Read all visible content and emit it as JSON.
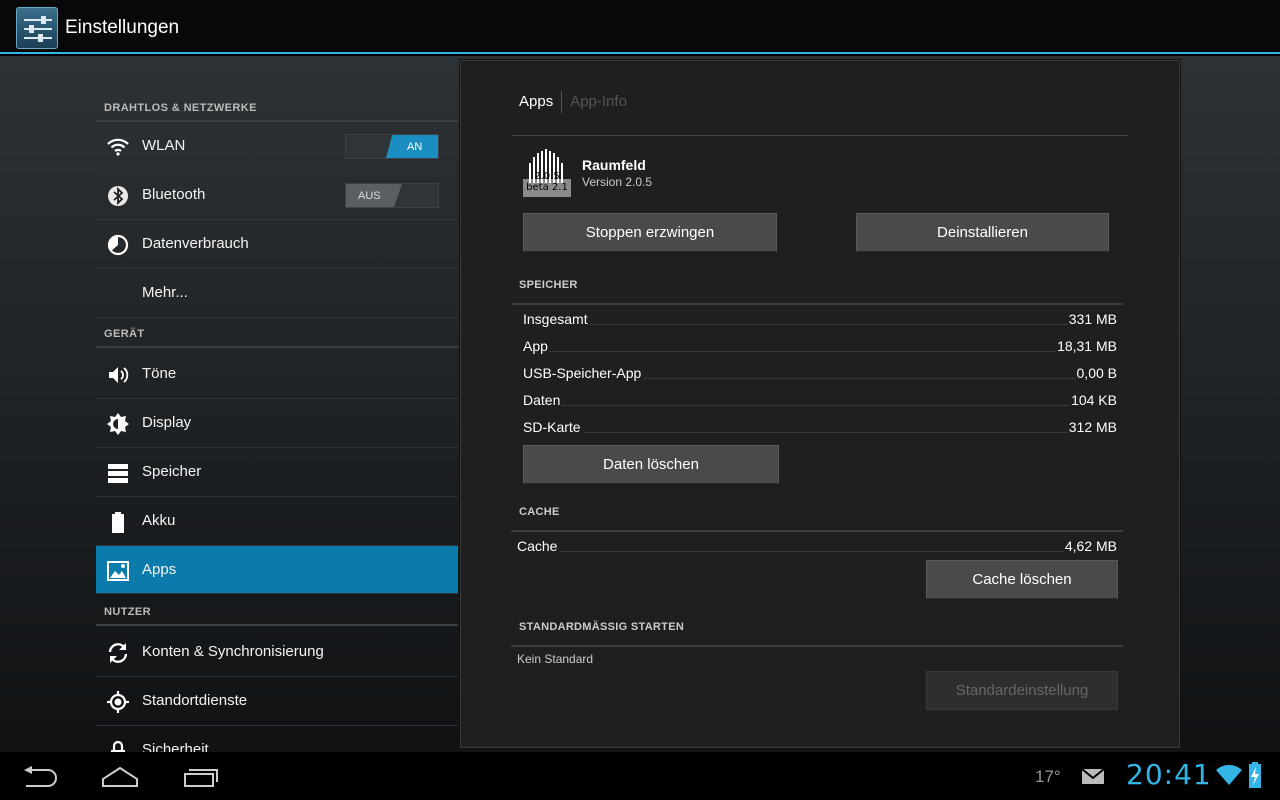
{
  "actionbar": {
    "title": "Einstellungen",
    "icon": "settings-sliders-icon"
  },
  "sidebar": {
    "sections": [
      {
        "header": "DRAHTLOS & NETZWERKE"
      },
      {
        "header": "GERÄT"
      },
      {
        "header": "NUTZER"
      }
    ],
    "items": [
      {
        "label": "WLAN",
        "icon": "wifi-icon",
        "toggle": "AN",
        "toggle_state": "on"
      },
      {
        "label": "Bluetooth",
        "icon": "bluetooth-icon",
        "toggle": "AUS",
        "toggle_state": "off"
      },
      {
        "label": "Datenverbrauch",
        "icon": "data-usage-icon"
      },
      {
        "label": "Mehr..."
      },
      {
        "label": "Töne",
        "icon": "speaker-icon"
      },
      {
        "label": "Display",
        "icon": "brightness-icon"
      },
      {
        "label": "Speicher",
        "icon": "storage-icon"
      },
      {
        "label": "Akku",
        "icon": "battery-icon"
      },
      {
        "label": "Apps",
        "icon": "apps-icon",
        "selected": true
      },
      {
        "label": "Konten & Synchronisierung",
        "icon": "sync-icon"
      },
      {
        "label": "Standortdienste",
        "icon": "location-icon"
      },
      {
        "label": "Sicherheit",
        "icon": "lock-icon"
      }
    ]
  },
  "panel": {
    "breadcrumb": {
      "active": "Apps",
      "inactive": "App-Info"
    },
    "app": {
      "name": "Raumfeld",
      "version": "Version 2.0.5",
      "icon_text_1": "2.0.5",
      "icon_text_2": "beta 2.1"
    },
    "buttons": {
      "force_stop": "Stoppen erzwingen",
      "uninstall": "Deinstallieren",
      "clear_data": "Daten löschen",
      "clear_cache": "Cache löschen",
      "clear_defaults": "Standardeinstellung"
    },
    "storage": {
      "header": "SPEICHER",
      "rows": [
        {
          "label": "Insgesamt",
          "value": "331 MB"
        },
        {
          "label": "App",
          "value": "18,31 MB"
        },
        {
          "label": "USB-Speicher-App",
          "value": "0,00 B"
        },
        {
          "label": "Daten",
          "value": "104 KB"
        },
        {
          "label": "SD-Karte",
          "value": "312 MB"
        }
      ]
    },
    "cache": {
      "header": "CACHE",
      "label": "Cache",
      "value": "4,62 MB"
    },
    "launch": {
      "header": "STANDARDMÄSSIG STARTEN",
      "text": "Kein Standard"
    }
  },
  "statusbar": {
    "temperature": "17°",
    "clock": "20:41",
    "accent": "#33b5e5"
  }
}
